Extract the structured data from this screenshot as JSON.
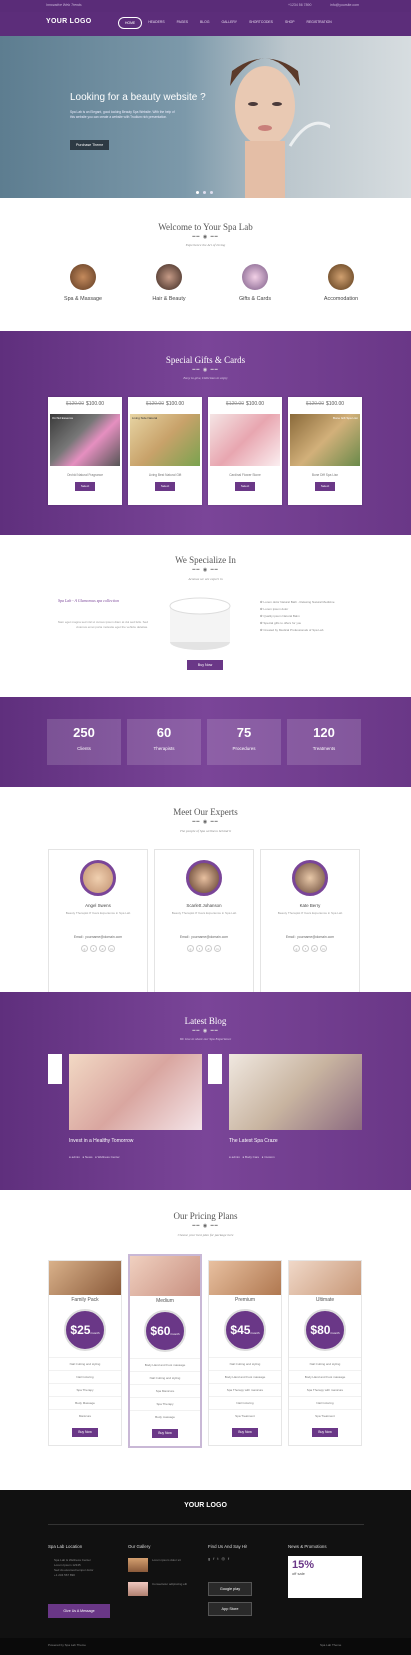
{
  "topbar": {
    "tagline": "Innovative Web Trends",
    "phone": "+1234 56 7890",
    "email": "info@yoursite.com"
  },
  "nav": {
    "logo": "YOUR LOGO",
    "items": [
      "HOME",
      "HEADERS",
      "PAGES",
      "BLOG",
      "GALLERY",
      "SHORTCODES",
      "SHOP",
      "REGISTRATION"
    ]
  },
  "hero": {
    "title": "Looking for a beauty website ?",
    "text": "Spa Lab is an Elegant, good looking Beauty Spa Website. With the help of this website you can create a website with Trudium rich presentation.",
    "button": "Purchase Theme"
  },
  "welcome": {
    "title": "Welcome to Your Spa Lab",
    "subtitle": "Experience the Art of Living",
    "features": [
      "Spa & Massage",
      "Hair & Beauty",
      "Gifts & Cards",
      "Accomodation"
    ]
  },
  "gifts": {
    "title": "Special Gifts & Cards",
    "subtitle": "Easy to give, Delicious to enjoy",
    "cards": [
      {
        "old": "$120.00",
        "price": "$100.00",
        "name": "Orchid Natural Fragrance",
        "tag": "Orchid Essence",
        "button": "Select"
      },
      {
        "old": "$120.00",
        "price": "$100.00",
        "name": "Living Best Natural Gift",
        "tag": "Living Side Natural",
        "button": "Select"
      },
      {
        "old": "$120.00",
        "price": "$100.00",
        "name": "Cardinal Flower Stone",
        "tag": "",
        "button": "Select"
      },
      {
        "old": "$120.00",
        "price": "$100.00",
        "name": "Bone Diff Spa Lisn",
        "tag": "Bone Gift Spa Lisn",
        "button": "Select"
      }
    ]
  },
  "specialize": {
    "title": "We Specialize In",
    "subtitle": "Aromas we are expert in",
    "tag": "Spa Lab - A Glamorous spa collection",
    "text": "Nam eget magna sed nisl ut cursus ipsum diam at dui sed felis. Sed vivamus emet porta molestie eget the vehicle deleitas.",
    "list": [
      "Lorem dolor Natural Bath - Relaxing Natural Medicine",
      "Lorem ipsum dolor",
      "Quality ipsum Natural Balm",
      "Special gifts to offers for you",
      "Created by Medical Professionals of Spa Lab"
    ],
    "button": "Buy Now"
  },
  "stats": [
    {
      "n": "250",
      "l": "Clients"
    },
    {
      "n": "60",
      "l": "Therapists"
    },
    {
      "n": "75",
      "l": "Procedures"
    },
    {
      "n": "120",
      "l": "Treatments"
    }
  ],
  "experts": {
    "title": "Meet Our Experts",
    "subtitle": "The people of Spa wellness behind it",
    "people": [
      {
        "name": "Angel Swens",
        "desc": "Beauty Therapist 8 Years Experience in Spa Lab",
        "email": "Email : yourname@domain.com"
      },
      {
        "name": "Scarlett Johanson",
        "desc": "Beauty Therapist 8 Years Experience in Spa Lab",
        "email": "Email : yourname@domain.com"
      },
      {
        "name": "Kate Berry",
        "desc": "Beauty Therapist 8 Years Experience in Spa Lab",
        "email": "Email : yourname@domain.com"
      }
    ]
  },
  "blog": {
    "title": "Latest Blog",
    "subtitle": "We love to share our Spa Experience",
    "posts": [
      {
        "title": "Invest in a Healthy Tomorrow",
        "meta": [
          "admin",
          "News",
          "Wellness Center"
        ]
      },
      {
        "title": "The Latest Spa Craze",
        "meta": [
          "admin",
          "Body Care",
          "Custom"
        ]
      }
    ]
  },
  "pricing": {
    "title": "Our Pricing Plans",
    "subtitle": "Choose your best plan for package here",
    "plans": [
      {
        "name": "Family Pack",
        "price": "$25",
        "per": "/month",
        "items": [
          "Nail Cutting and styling",
          "Nail Coloring",
          "Spa Therapy",
          "Body Massage",
          "Manicure"
        ],
        "button": "Buy Now"
      },
      {
        "name": "Medium",
        "price": "$60",
        "per": "/month",
        "items": [
          "Body Hand and Foot massage",
          "Nail Cutting and styling",
          "Spa Manicure",
          "Spa Therapy",
          "Body massage"
        ],
        "button": "Buy Now"
      },
      {
        "name": "Premium",
        "price": "$45",
        "per": "/month",
        "items": [
          "Nail Cutting and styling",
          "Body Hand and Foot massage",
          "Spa Therapy with manicure",
          "Nail Coloring",
          "Spa Treatment"
        ],
        "button": "Buy Now"
      },
      {
        "name": "Ultimate",
        "price": "$80",
        "per": "/month",
        "items": [
          "Nail Cutting and styling",
          "Body Hand and Foot massage",
          "Spa Therapy with manicure",
          "Nail Coloring",
          "Spa Treatment"
        ],
        "button": "Buy Now"
      }
    ]
  },
  "footer": {
    "logo": "YOUR LOGO",
    "cols": [
      "Spa Lab Location",
      "Our Gallery",
      "Find Us And Say Hi!",
      "News & Promotions"
    ],
    "address": [
      "Spa Lab & Wellness Center",
      "Lorem Ipsum 12345",
      "Sed do eiusmod tempor dolor",
      "+1 234 567 890"
    ],
    "button": "Give Us A Message",
    "gallery": [
      "Lorem ipsum dolor sit",
      "Consectetur adipiscing elit"
    ],
    "google": "Google play",
    "apple": "App Store",
    "promo": "15%",
    "promo_sub": "off sale",
    "copyright": "Powered by Spa Lab Theme",
    "bottom": "Spa Lab Theme"
  }
}
